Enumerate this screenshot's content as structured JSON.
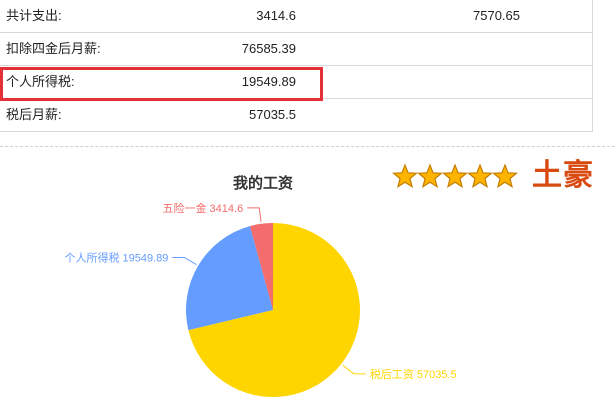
{
  "summary_rows": [
    {
      "label": "共计支出:",
      "value1": "3414.6",
      "value2": "7570.65"
    },
    {
      "label": "扣除四金后月薪:",
      "value1": "76585.39",
      "value2": ""
    },
    {
      "label": "个人所得税:",
      "value1": "19549.89",
      "value2": ""
    },
    {
      "label": "税后月薪:",
      "value1": "57035.5",
      "value2": ""
    }
  ],
  "highlight_color": "#e5303a",
  "rating": {
    "stars": 5,
    "title": "土豪",
    "title_color": "#d94a10",
    "star_icon": "star-icon"
  },
  "chart_data": {
    "type": "pie",
    "title": "我的工资",
    "slices": [
      {
        "name": "五险一金",
        "value": 3414.6,
        "label": "五险一金 3414.6",
        "color": "#f46c6c"
      },
      {
        "name": "个人所得税",
        "value": 19549.89,
        "label": "个人所得税 19549.89",
        "color": "#659cff"
      },
      {
        "name": "税后工资",
        "value": 57035.5,
        "label": "税后工资 57035.5",
        "color": "#ffd500"
      }
    ],
    "legend": "none"
  }
}
